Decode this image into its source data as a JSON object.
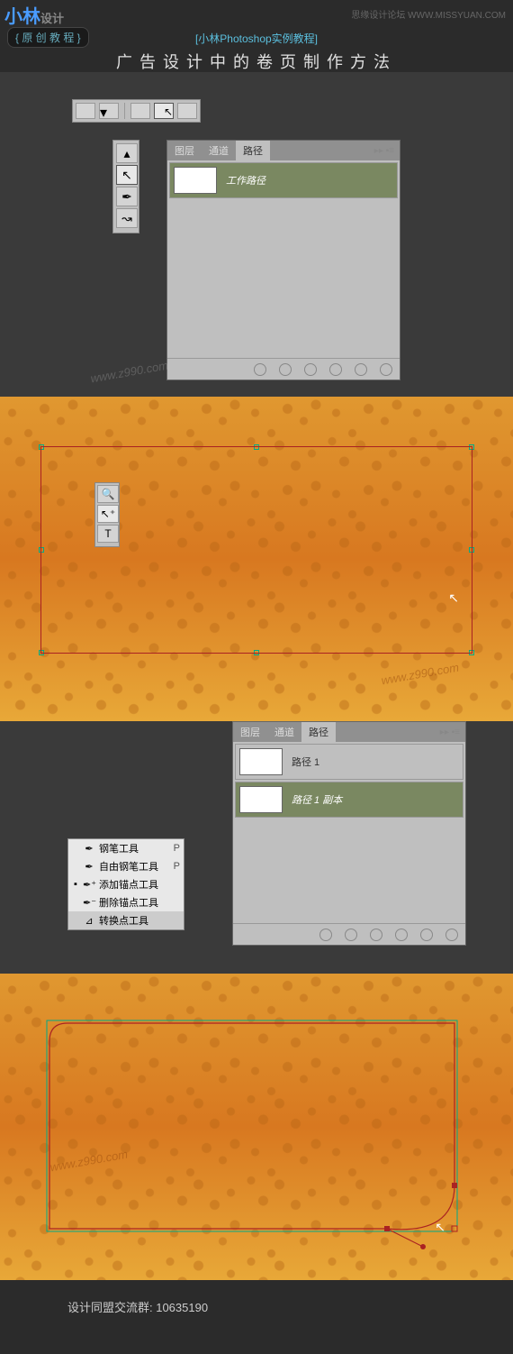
{
  "header": {
    "logo_main": "小林",
    "logo_sub": "设计",
    "tag": "{ 原 创 教 程 }",
    "topright": "思缘设计论坛  WWW.MISSYUAN.COM",
    "subtitle": "[小林Photoshop实例教程]",
    "title": "广告设计中的卷页制作方法"
  },
  "panel1": {
    "tabs": [
      "图层",
      "通道",
      "路径"
    ],
    "active_tab": "路径",
    "rows": [
      {
        "label": "工作路径"
      }
    ]
  },
  "panel2": {
    "tabs": [
      "图层",
      "通道",
      "路径"
    ],
    "active_tab": "路径",
    "rows": [
      {
        "label": "路径 1"
      },
      {
        "label": "路径 1 副本"
      }
    ]
  },
  "pen_menu": {
    "items": [
      {
        "icon": "✒",
        "label": "钢笔工具",
        "key": "P"
      },
      {
        "icon": "✒",
        "label": "自由钢笔工具",
        "key": "P"
      },
      {
        "icon": "✒⁺",
        "label": "添加锚点工具",
        "key": ""
      },
      {
        "icon": "✒⁻",
        "label": "删除锚点工具",
        "key": ""
      },
      {
        "icon": "⊿",
        "label": "转换点工具",
        "key": ""
      }
    ]
  },
  "watermark": "www.z990.com",
  "footer": "设计同盟交流群: 10635190"
}
